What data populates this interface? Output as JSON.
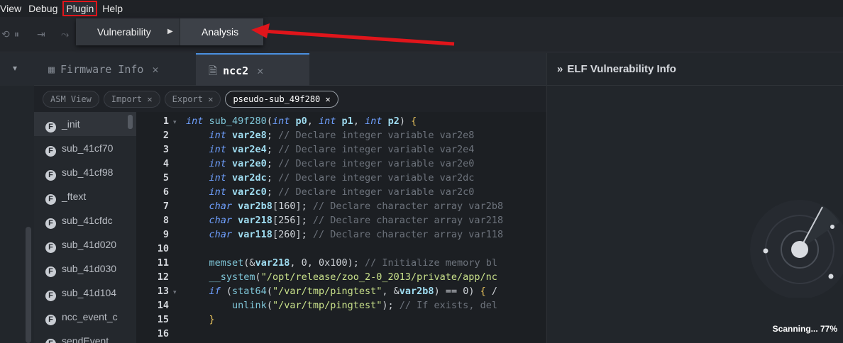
{
  "menubar": {
    "items": [
      "View",
      "Debug",
      "Plugin",
      "Help"
    ]
  },
  "dropdown": {
    "vulnerability_label": "Vulnerability",
    "analysis_label": "Analysis"
  },
  "tabs": [
    {
      "label": "Firmware Info",
      "active": false
    },
    {
      "label": "ncc2",
      "active": true
    }
  ],
  "subtabs": [
    {
      "label": "ASM View",
      "closable": false
    },
    {
      "label": "Import",
      "closable": true
    },
    {
      "label": "Export",
      "closable": true
    },
    {
      "label": "pseudo-sub_49f280",
      "closable": true,
      "active": true
    }
  ],
  "functions": [
    "_init",
    "sub_41cf70",
    "sub_41cf98",
    "_ftext",
    "sub_41cfdc",
    "sub_41d020",
    "sub_41d030",
    "sub_41d104",
    "ncc_event_c",
    "sendEvent"
  ],
  "code": {
    "line_numbers": [
      "1",
      "2",
      "3",
      "4",
      "5",
      "6",
      "7",
      "8",
      "9",
      "10",
      "11",
      "12",
      "13",
      "14",
      "15",
      "16"
    ],
    "lines": [
      "int sub_49f280(int p0, int p1, int p2) {",
      "    int var2e8; // Declare integer variable var2e8",
      "    int var2e4; // Declare integer variable var2e4",
      "    int var2e0; // Declare integer variable var2e0",
      "    int var2dc; // Declare integer variable var2dc",
      "    int var2c0; // Declare integer variable var2c0",
      "    char var2b8[160]; // Declare character array var2b8",
      "    char var218[256]; // Declare character array var218",
      "    char var118[260]; // Declare character array var118",
      "",
      "    memset(&var218, 0, 0x100); // Initialize memory bl",
      "    __system(\"/opt/release/zoo_2-0_2013/private/app/nc",
      "    if (stat64(\"/var/tmp/pingtest\", &var2b8) == 0) { /",
      "        unlink(\"/var/tmp/pingtest\"); // If exists, del",
      "    }",
      ""
    ]
  },
  "right_panel": {
    "title": "ELF Vulnerability Info",
    "collapse_glyph": "»",
    "scan_status": "Scanning... 77%",
    "scan_progress": 0.77
  },
  "colors": {
    "highlight_red": "#e0151b",
    "accent_blue": "#4a8fe0"
  }
}
